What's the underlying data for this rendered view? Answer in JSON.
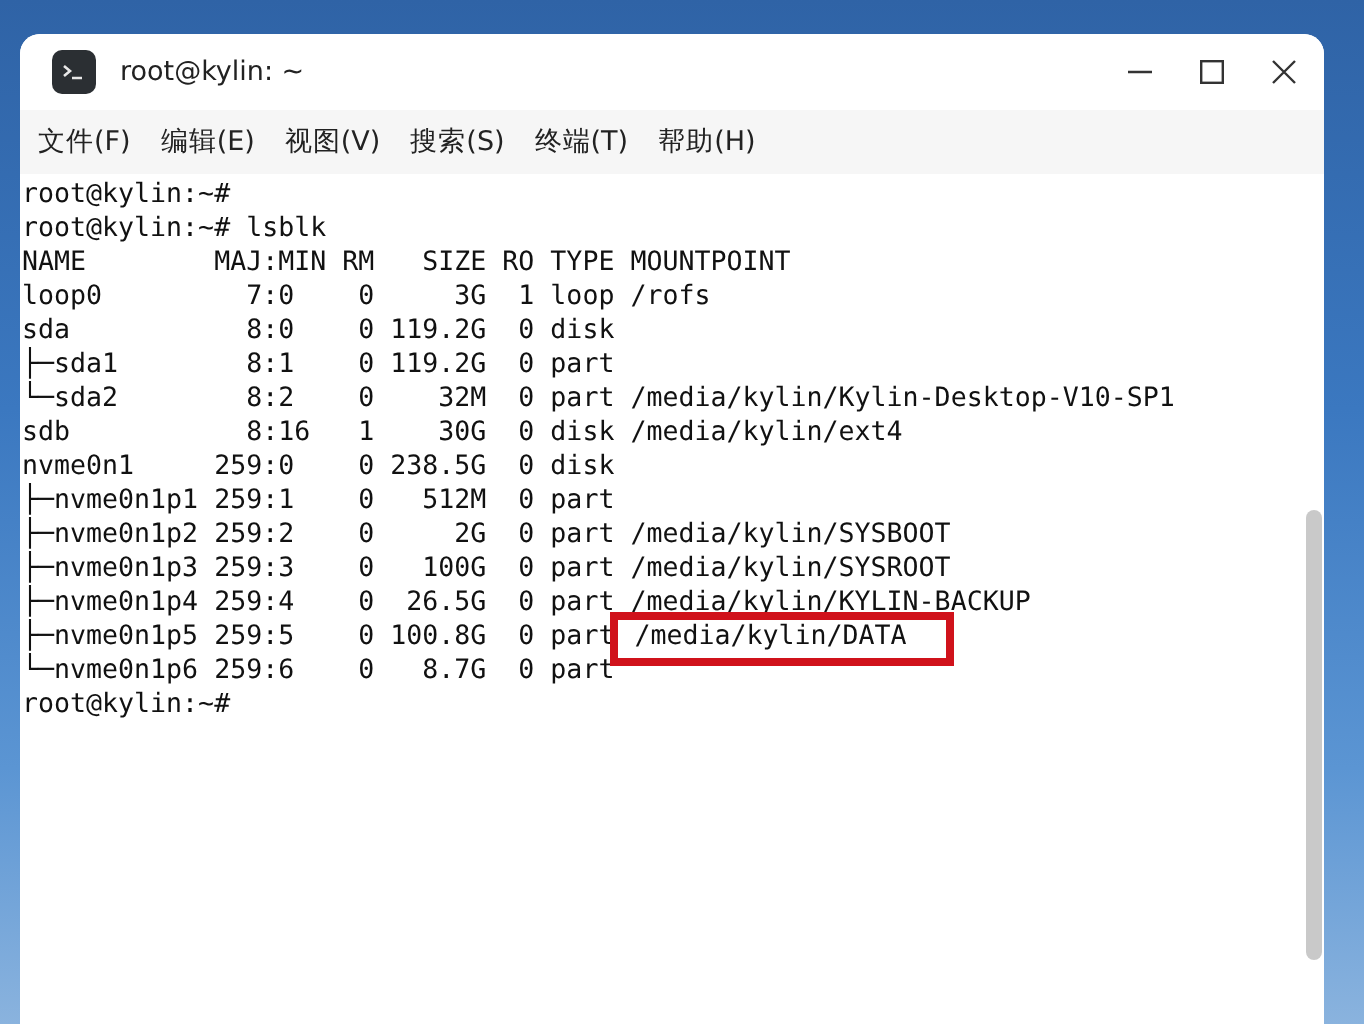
{
  "window": {
    "title": "root@kylin: ~"
  },
  "menu": [
    {
      "label": "文件(F)"
    },
    {
      "label": "编辑(E)"
    },
    {
      "label": "视图(V)"
    },
    {
      "label": "搜索(S)"
    },
    {
      "label": "终端(T)"
    },
    {
      "label": "帮助(H)"
    }
  ],
  "terminal": {
    "lines": [
      {
        "text": "root@kylin:~#"
      },
      {
        "text": "root@kylin:~# lsblk"
      },
      {
        "text": "NAME        MAJ:MIN RM   SIZE RO TYPE MOUNTPOINT"
      },
      {
        "text": "loop0         7:0    0     3G  1 loop /rofs"
      },
      {
        "text": "sda           8:0    0 119.2G  0 disk"
      },
      {
        "text": "├─sda1        8:1    0 119.2G  0 part"
      },
      {
        "text": "└─sda2        8:2    0    32M  0 part /media/kylin/Kylin-Desktop-V10-SP1"
      },
      {
        "text": "sdb           8:16   1    30G  0 disk /media/kylin/ext4"
      },
      {
        "text": "nvme0n1     259:0    0 238.5G  0 disk"
      },
      {
        "text": "├─nvme0n1p1 259:1    0   512M  0 part"
      },
      {
        "text": "├─nvme0n1p2 259:2    0     2G  0 part /media/kylin/SYSBOOT"
      },
      {
        "text": "├─nvme0n1p3 259:3    0   100G  0 part /media/kylin/SYSROOT"
      },
      {
        "text": "├─nvme0n1p4 259:4    0  26.5G  0 part /media/kylin/KYLIN-BACKUP"
      },
      {
        "text": "├─nvme0n1p5 259:5    0 100.8G  0 part",
        "highlight": "/media/kylin/DATA"
      },
      {
        "text": "└─nvme0n1p6 259:6    0   8.7G  0 part"
      },
      {
        "text": "root@kylin:~#"
      }
    ]
  }
}
